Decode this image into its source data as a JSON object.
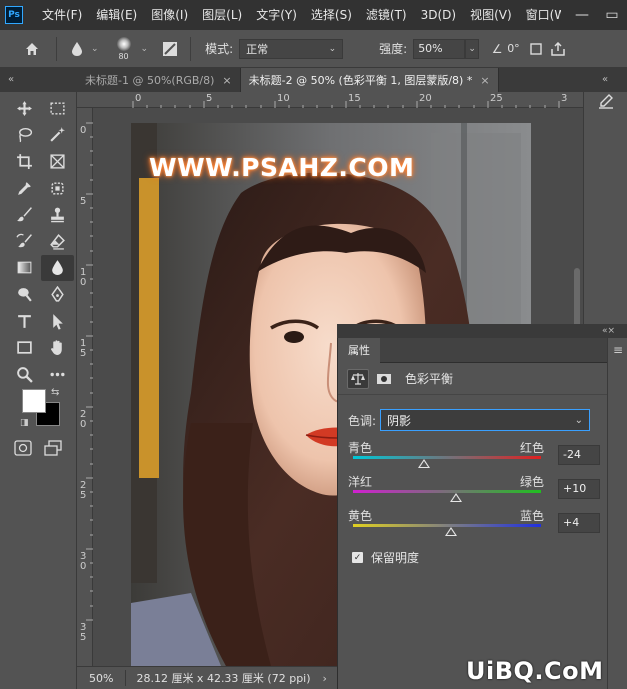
{
  "app": {
    "logo": "Ps"
  },
  "menu": [
    "文件(F)",
    "编辑(E)",
    "图像(I)",
    "图层(L)",
    "文字(Y)",
    "选择(S)",
    "滤镜(T)",
    "3D(D)",
    "视图(V)",
    "窗口(W"
  ],
  "window_controls": {
    "minimize": "—",
    "maximize": "▭"
  },
  "options": {
    "brush_size": "80",
    "mode_label": "模式:",
    "mode_value": "正常",
    "strength_label": "强度:",
    "strength_value": "50%",
    "angle_value": "0°"
  },
  "collapse_glyph": "«",
  "panel_collapse_glyph": "«×",
  "tabs": [
    {
      "label": "未标题-1 @ 50%(RGB/8)",
      "close": "×",
      "active": false
    },
    {
      "label": "未标题-2 @ 50% (色彩平衡 1, 图层蒙版/8) *",
      "close": "×",
      "active": true
    }
  ],
  "ruler_h": [
    "0",
    "5",
    "10",
    "15",
    "20",
    "25",
    "3"
  ],
  "ruler_v": [
    "0",
    "5",
    "1 0",
    "1 5",
    "2 0",
    "2 5",
    "3 0",
    "3 5"
  ],
  "canvas": {
    "watermark": "WWW.PSAHZ.COM"
  },
  "status": {
    "zoom": "50%",
    "doc_info": "28.12 厘米 x 42.33 厘米 (72 ppi)",
    "arrow": "›"
  },
  "properties": {
    "tab": "属性",
    "menu_glyph": "≡",
    "title": "色彩平衡",
    "tone_label": "色调:",
    "tone_value": "阴影",
    "sliders": [
      {
        "left": "青色",
        "right": "红色",
        "value": -24,
        "display": "-24",
        "from": "#00c8d8",
        "to": "#e02020"
      },
      {
        "left": "洋红",
        "right": "绿色",
        "value": 10,
        "display": "+10",
        "from": "#d020d0",
        "to": "#20c020"
      },
      {
        "left": "黄色",
        "right": "蓝色",
        "value": 4,
        "display": "+4",
        "from": "#e0d020",
        "to": "#2030e0"
      }
    ],
    "preserve_label": "保留明度",
    "preserve_checked": true
  },
  "site_watermark": "UiBQ.CoM",
  "colors": {
    "foreground": "#ffffff",
    "background": "#000000",
    "accent": "#3aa0ff"
  }
}
